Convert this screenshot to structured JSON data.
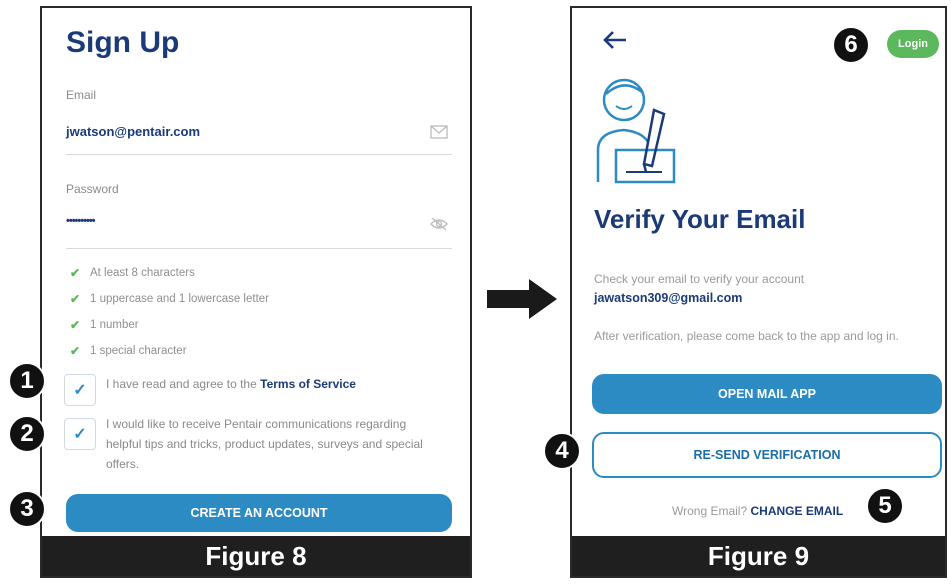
{
  "figure8": {
    "caption": "Figure 8",
    "title": "Sign Up",
    "email_label": "Email",
    "email_value": "jwatson@pentair.com",
    "password_label": "Password",
    "password_value": "••••••••••",
    "requirements": [
      "At least 8 characters",
      "1 uppercase and 1 lowercase letter",
      "1 number",
      "1 special character"
    ],
    "terms_prefix": "I have read and agree to the ",
    "terms_link": "Terms of Service",
    "communications_text": "I would like to receive Pentair communications regarding helpful tips and tricks, product updates, surveys and special offers.",
    "create_button": "CREATE AN ACCOUNT",
    "callouts": [
      "1",
      "2",
      "3"
    ]
  },
  "figure9": {
    "caption": "Figure 9",
    "login_label": "Login",
    "title": "Verify Your Email",
    "check_text": "Check your email to verify your account",
    "email": "jawatson309@gmail.com",
    "after_text": "After verification, please come back to the app and log in.",
    "open_mail_button": "OPEN MAIL APP",
    "resend_button": "RE-SEND VERIFICATION",
    "wrong_email_text": "Wrong Email?",
    "change_email_link": "CHANGE EMAIL",
    "callouts": [
      "4",
      "5",
      "6"
    ]
  },
  "colors": {
    "brand_navy": "#1b3a78",
    "button_blue": "#2d8bc3",
    "success_green": "#5cb85c"
  }
}
